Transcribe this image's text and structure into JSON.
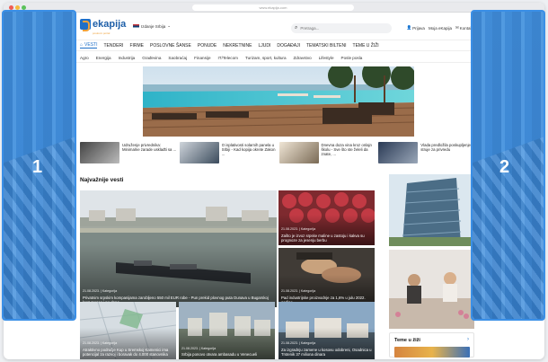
{
  "browser": {
    "url": "www.ekapija.com"
  },
  "header": {
    "logo_text": "ekapija",
    "logo_tagline": "poslovni portal",
    "edition": "Izdanje Srbija",
    "search_placeholder": "Pretraga...",
    "links": {
      "login": "Prijava",
      "my": "Moja eKapija",
      "contact": "Kontakt"
    }
  },
  "main_nav": [
    "VESTI",
    "TENDERI",
    "FIRME",
    "POSLOVNE ŠANSE",
    "PONUDE",
    "NEKRETNINE",
    "LJUDI",
    "DOGAĐAJI",
    "TEMATSKI BILTENI",
    "TEME U ŽIŽI"
  ],
  "sub_nav": [
    "Agro",
    "Energija",
    "Industrija",
    "Građevina",
    "Saobraćaj",
    "Finansije",
    "IT/Telecom",
    "Turizam, sport, kultura",
    "Zdravstvo",
    "Lifestyle",
    "Posle posla"
  ],
  "tickers": [
    {
      "text": "Udruženje privrednika: Minimalne zarade usklađti sa ..."
    },
    {
      "text": "O isplativosti solarnih panela u Srbiji - Kad kopija okrete Zakon ..."
    },
    {
      "text": "Dnevna doza vina kroz onlajn školu - Sve što ste želeli da znate, ..."
    },
    {
      "text": "Vlada predložila poskupljenje struje za privredu"
    }
  ],
  "section_title": "Najvažnije vesti",
  "stories": {
    "main": {
      "meta": "21.08.2023. | Kategorija",
      "title": "Privatnim srpskim kompanijama zarobljeno 550 mil EUR robe - Pun prekid plovnog puta Dunava u Bugarskoj kroz mesec i po dana"
    },
    "s1": {
      "meta": "21.08.2023. | Kategorija",
      "title": "Zašto je izvoz srpske maline u zastoju i kakva su prognoze za jesenju berbu"
    },
    "s2": {
      "meta": "21.08.2023. | Kategorija",
      "title": "Pad industrijske proizvodnje za 1,6% u julu 2022. godine"
    },
    "b1": {
      "meta": "21.08.2023. | Kategorija",
      "title": "Atraktivno područje Kup u Sremskoj Kamenici ima potencijal za razvoj i boravak do 4.000 stanovnika"
    },
    "b2": {
      "meta": "21.08.2023. | Kategorija",
      "title": "Srbija ponovo otvara ambasadu u Venecueli"
    },
    "b3": {
      "meta": "21.08.2023. | Kategorija",
      "title": "Za izgradnju zamene u kosovu odobreni, Osadnica u Trstenik 37 miliona dinara"
    }
  },
  "teme_title": "Teme u žiži",
  "overlays": {
    "left": "1",
    "right": "2"
  },
  "colors": {
    "brand": "#1e6fc8",
    "accent": "#f0a23b",
    "overlay": "#3b8fe6"
  }
}
